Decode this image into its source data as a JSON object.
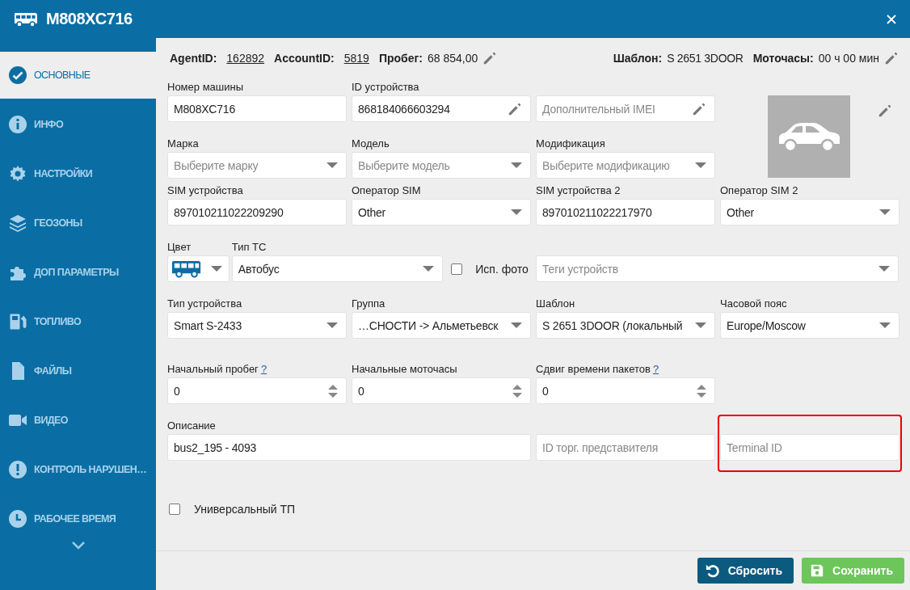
{
  "window": {
    "title": "M808XC716"
  },
  "sidebar": {
    "items": [
      {
        "label": "ОСНОВНЫЕ",
        "selected": true
      },
      {
        "label": "ИНФО",
        "selected": false
      },
      {
        "label": "НАСТРОЙКИ",
        "selected": false
      },
      {
        "label": "ГЕОЗОНЫ",
        "selected": false
      },
      {
        "label": "ДОП ПАРАМЕТРЫ",
        "selected": false
      },
      {
        "label": "ТОПЛИВО",
        "selected": false
      },
      {
        "label": "ФАЙЛЫ",
        "selected": false
      },
      {
        "label": "ВИДЕО",
        "selected": false
      },
      {
        "label": "КОНТРОЛЬ НАРУШЕН…",
        "selected": false
      },
      {
        "label": "РАБОЧЕЕ ВРЕМЯ",
        "selected": false
      }
    ]
  },
  "info_bar": {
    "agent_label": "AgentID:",
    "agent_id": "162892",
    "account_label": "AccountID:",
    "account_id": "5819",
    "mileage_label": "Пробег:",
    "mileage": "68 854,00",
    "template_label": "Шаблон:",
    "template": "S 2651 3DOOR",
    "hours_label": "Моточасы:",
    "hours": "00 ч 00 мин"
  },
  "form": {
    "plate": {
      "label": "Номер машины",
      "value": "M808XC716"
    },
    "device_id": {
      "label": "ID устройства",
      "value": "868184066603294"
    },
    "extra_imei": {
      "placeholder": "Дополнительный IMEI"
    },
    "brand": {
      "label": "Марка",
      "placeholder": "Выберите марку"
    },
    "model": {
      "label": "Модель",
      "placeholder": "Выберите модель"
    },
    "modification": {
      "label": "Модификация",
      "placeholder": "Выберите модификацию"
    },
    "sim1": {
      "label": "SIM устройства",
      "value": "897010211022209290"
    },
    "sim_operator1": {
      "label": "Оператор SIM",
      "value": "Other"
    },
    "sim2": {
      "label": "SIM устройства 2",
      "value": "897010211022217970"
    },
    "sim_operator2": {
      "label": "Оператор SIM 2",
      "value": "Other"
    },
    "color": {
      "label": "Цвет"
    },
    "vehicle_type": {
      "label": "Тип ТС",
      "value": "Автобус"
    },
    "use_photo": {
      "label": "Исп. фото",
      "checked": false
    },
    "tags": {
      "placeholder": "Теги устройств"
    },
    "device_type": {
      "label": "Тип устройства",
      "value": "Smart S-2433"
    },
    "group": {
      "label": "Группа",
      "value": "…СНОСТИ -> Альметьевск"
    },
    "template": {
      "label": "Шаблон",
      "value": "S 2651 3DOOR (локальный"
    },
    "timezone": {
      "label": "Часовой пояс",
      "value": "Europe/Moscow"
    },
    "initial_mileage": {
      "label": "Начальный пробег",
      "help": "?",
      "value": "0"
    },
    "initial_hours": {
      "label": "Начальные моточасы",
      "value": "0"
    },
    "time_shift": {
      "label": "Сдвиг времени пакетов",
      "help": "?",
      "value": "0"
    },
    "description": {
      "label": "Описание",
      "value": "bus2_195 - 4093"
    },
    "sales_rep_id": {
      "placeholder": "ID торг. представителя"
    },
    "terminal_id": {
      "placeholder": "Terminal ID",
      "highlighted": true
    },
    "universal": {
      "label": "Универсальный ТП",
      "checked": false
    }
  },
  "buttons": {
    "reset": "Сбросить",
    "save": "Сохранить"
  }
}
